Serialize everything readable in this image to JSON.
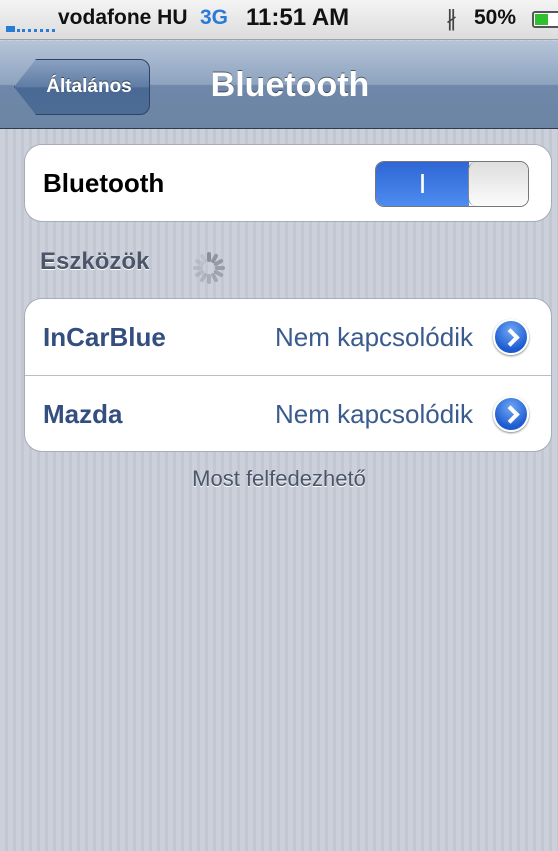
{
  "status_bar": {
    "carrier": "vodafone HU",
    "network": "3G",
    "time": "11:51 AM",
    "battery_percent": "50%",
    "battery_level": 0.5,
    "bluetooth_icon": "bluetooth-icon"
  },
  "nav": {
    "back_label": "Általános",
    "title": "Bluetooth"
  },
  "bluetooth": {
    "label": "Bluetooth",
    "toggle_on_text": "I",
    "enabled": true
  },
  "devices": {
    "header": "Eszközök",
    "items": [
      {
        "name": "InCarBlue",
        "status": "Nem kapcsolódik"
      },
      {
        "name": "Mazda",
        "status": "Nem kapcsolódik"
      }
    ]
  },
  "footer": {
    "text": "Most felfedezhető"
  },
  "colors": {
    "accent": "#2a7bd6",
    "toggle_on": "#3a78e0",
    "device_label": "#344e7f",
    "value_text": "#3a5b8e"
  }
}
